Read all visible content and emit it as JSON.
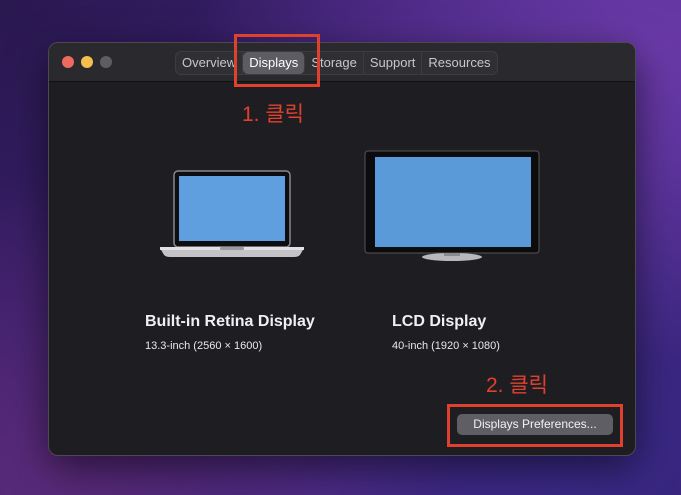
{
  "window": {
    "tabs": [
      {
        "label": "Overview"
      },
      {
        "label": "Displays"
      },
      {
        "label": "Storage"
      },
      {
        "label": "Support"
      },
      {
        "label": "Resources"
      }
    ],
    "active_tab": "Displays"
  },
  "annotations": {
    "step1": "1. 클릭",
    "step2": "2. 클릭",
    "color": "#e0412f"
  },
  "displays": [
    {
      "name": "Built-in Retina Display",
      "spec": "13.3-inch (2560 × 1600)",
      "icon": "laptop-icon"
    },
    {
      "name": "LCD Display",
      "spec": "40-inch (1920 × 1080)",
      "icon": "monitor-icon"
    }
  ],
  "footer": {
    "preferences_button": "Displays Preferences..."
  }
}
